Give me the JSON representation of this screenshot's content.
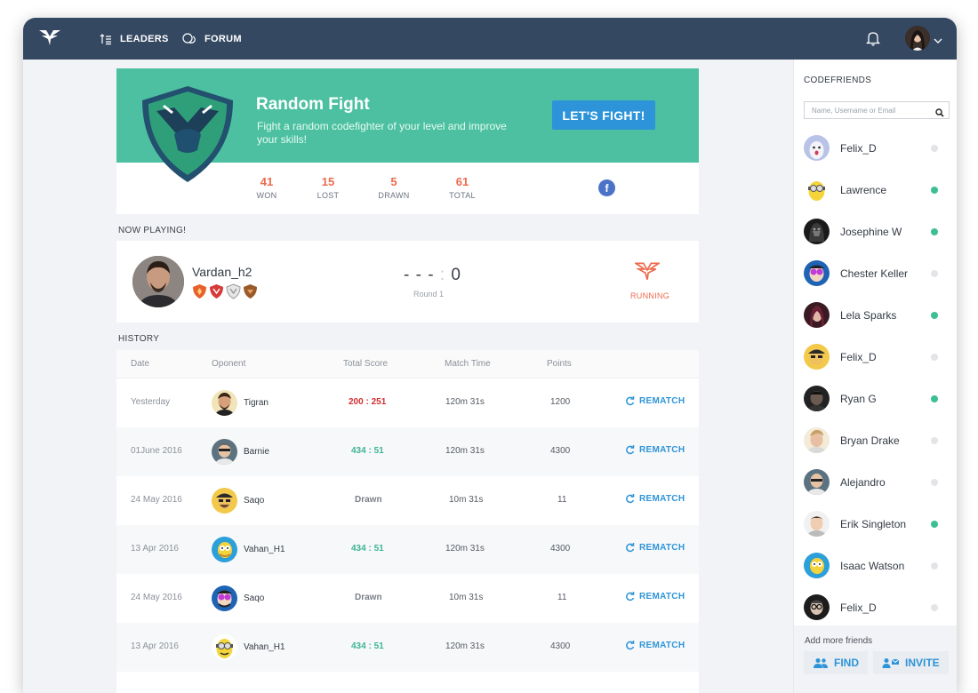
{
  "nav": {
    "leaders": "LEADERS",
    "forum": "FORUM"
  },
  "hero": {
    "title": "Random Fight",
    "subtitle": "Fight a random codefighter of your level and improve your skills!",
    "button": "LET'S FIGHT!"
  },
  "stats": [
    {
      "value": "41",
      "label": "WON"
    },
    {
      "value": "15",
      "label": "LOST"
    },
    {
      "value": "5",
      "label": "DRAWN"
    },
    {
      "value": "61",
      "label": "TOTAL"
    }
  ],
  "now_playing": {
    "label": "NOW PLAYING!",
    "player": "Vardan_h2",
    "score_left": "- - -",
    "score_sep": ":",
    "score_right": "0",
    "round": "Round 1",
    "status": "RUNNING"
  },
  "history": {
    "label": "HISTORY",
    "columns": [
      "Date",
      "Oponent",
      "Total Score",
      "Match Time",
      "Points"
    ],
    "rematch_label": "REMATCH",
    "rows": [
      {
        "date": "Yesterday",
        "opponent": "Tigran",
        "score": "200 : 251",
        "time": "120m 31s",
        "points": "1200"
      },
      {
        "date": "01June 2016",
        "opponent": "Barnie",
        "score": "434 : 51",
        "time": "120m 31s",
        "points": "4300"
      },
      {
        "date": "24 May 2016",
        "opponent": "Saqo",
        "score": "Drawn",
        "time": "10m 31s",
        "points": "11"
      },
      {
        "date": "13 Apr 2016",
        "opponent": "Vahan_H1",
        "score": "434 : 51",
        "time": "120m 31s",
        "points": "4300"
      },
      {
        "date": "24 May 2016",
        "opponent": "Saqo",
        "score": "Drawn",
        "time": "10m 31s",
        "points": "11"
      },
      {
        "date": "13 Apr 2016",
        "opponent": "Vahan_H1",
        "score": "434 : 51",
        "time": "120m 31s",
        "points": "4300"
      }
    ]
  },
  "sidebar": {
    "title": "CODEFRIENDS",
    "search_placeholder": "Name, Username or Email",
    "friends": [
      {
        "name": "Felix_D",
        "online": false
      },
      {
        "name": "Lawrence",
        "online": true
      },
      {
        "name": "Josephine W",
        "online": true
      },
      {
        "name": "Chester Keller",
        "online": false
      },
      {
        "name": "Lela Sparks",
        "online": true
      },
      {
        "name": "Felix_D",
        "online": false
      },
      {
        "name": "Ryan G",
        "online": true
      },
      {
        "name": "Bryan Drake",
        "online": false
      },
      {
        "name": "Alejandro",
        "online": false
      },
      {
        "name": "Erik Singleton",
        "online": true
      },
      {
        "name": "Isaac Watson",
        "online": false
      },
      {
        "name": "Felix_D",
        "online": false
      }
    ],
    "add_more": "Add more friends",
    "find": "FIND",
    "invite": "INVITE"
  },
  "colors": {
    "topbar": "#354862",
    "hero": "#4cc0a0",
    "accent": "#2d94d9",
    "stat": "#ee6a4d",
    "online": "#3cbf94"
  }
}
